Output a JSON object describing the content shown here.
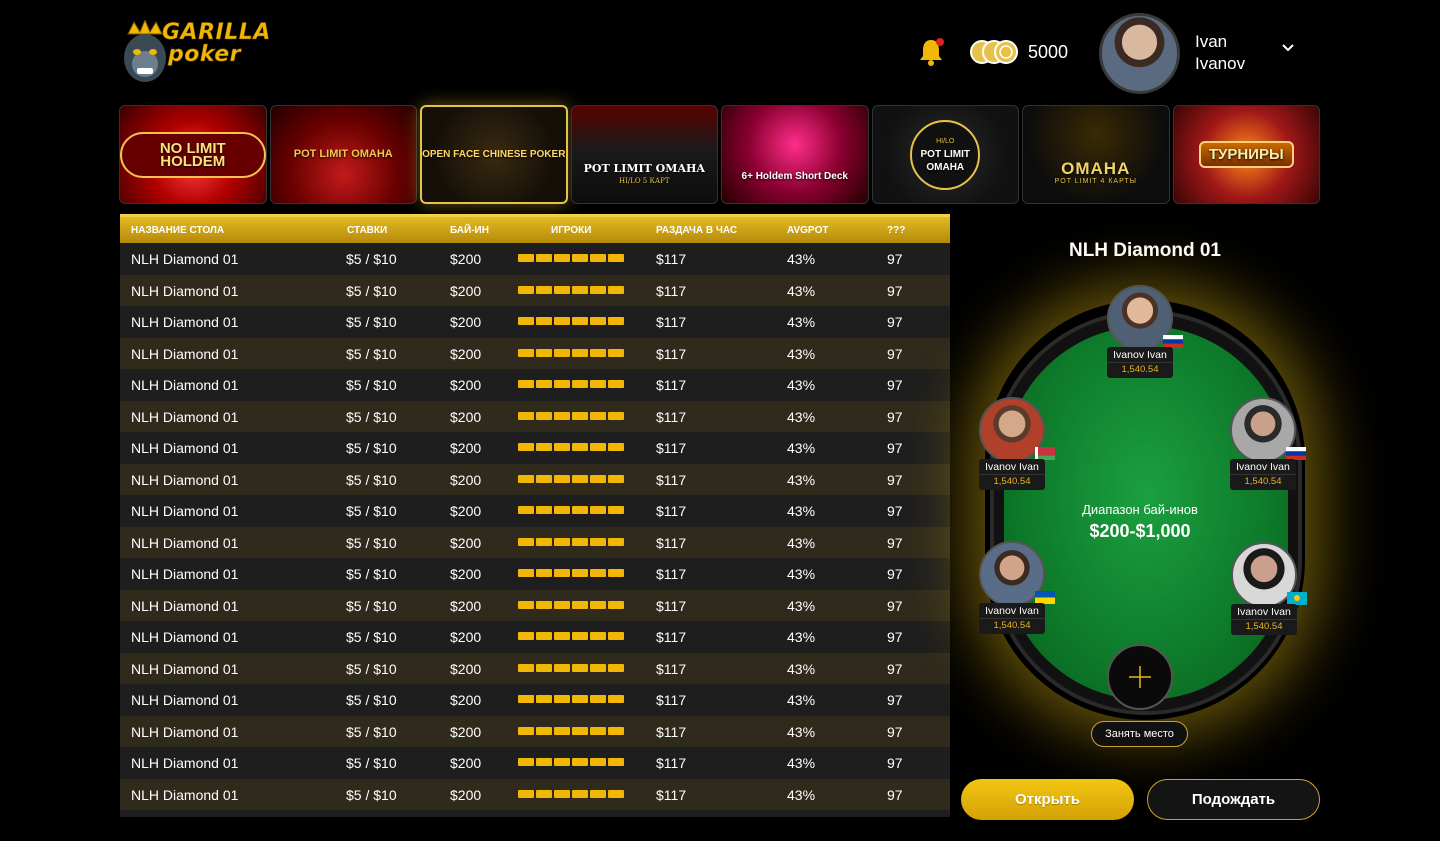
{
  "brand": {
    "line1": "GARILLA",
    "line2": "poker"
  },
  "header": {
    "balance": "5000",
    "user_first": "Ivan",
    "user_last": "Ivanov",
    "notification_icon": "bell-icon",
    "chips_icon": "chips-icon"
  },
  "games": [
    {
      "label": "NO LIMIT HOLDEM",
      "sub": ""
    },
    {
      "label": "POT LIMIT OMAHA",
      "sub": ""
    },
    {
      "label": "OPEN FACE CHINESE POKER",
      "sub": ""
    },
    {
      "label": "POT LIMIT OMAHA",
      "sub": "HI/LO 5 КАРТ"
    },
    {
      "label": "6+ Holdem Short Deck",
      "sub": ""
    },
    {
      "label": "POT LIMIT OMAHA",
      "sub": "HI/LO"
    },
    {
      "label": "OMAHA",
      "sub": "POT LIMIT 4 КАРТЫ"
    },
    {
      "label": "ТУРНИРЫ",
      "sub": ""
    }
  ],
  "table": {
    "headers": [
      "НАЗВАНИЕ СТОЛА",
      "СТАВКИ",
      "БАЙ-ИН",
      "ИГРОКИ",
      "РАЗДАЧА В ЧАС",
      "AVGPOT",
      "???"
    ],
    "players_filled": 6,
    "rows": [
      [
        "NLH Diamond 01",
        "$5 / $10",
        "$200",
        "$117",
        "43%",
        "97"
      ],
      [
        "NLH Diamond 01",
        "$5 / $10",
        "$200",
        "$117",
        "43%",
        "97"
      ],
      [
        "NLH Diamond 01",
        "$5 / $10",
        "$200",
        "$117",
        "43%",
        "97"
      ],
      [
        "NLH Diamond 01",
        "$5 / $10",
        "$200",
        "$117",
        "43%",
        "97"
      ],
      [
        "NLH Diamond 01",
        "$5 / $10",
        "$200",
        "$117",
        "43%",
        "97"
      ],
      [
        "NLH Diamond 01",
        "$5 / $10",
        "$200",
        "$117",
        "43%",
        "97"
      ],
      [
        "NLH Diamond 01",
        "$5 / $10",
        "$200",
        "$117",
        "43%",
        "97"
      ],
      [
        "NLH Diamond 01",
        "$5 / $10",
        "$200",
        "$117",
        "43%",
        "97"
      ],
      [
        "NLH Diamond 01",
        "$5 / $10",
        "$200",
        "$117",
        "43%",
        "97"
      ],
      [
        "NLH Diamond 01",
        "$5 / $10",
        "$200",
        "$117",
        "43%",
        "97"
      ],
      [
        "NLH Diamond 01",
        "$5 / $10",
        "$200",
        "$117",
        "43%",
        "97"
      ],
      [
        "NLH Diamond 01",
        "$5 / $10",
        "$200",
        "$117",
        "43%",
        "97"
      ],
      [
        "NLH Diamond 01",
        "$5 / $10",
        "$200",
        "$117",
        "43%",
        "97"
      ],
      [
        "NLH Diamond 01",
        "$5 / $10",
        "$200",
        "$117",
        "43%",
        "97"
      ],
      [
        "NLH Diamond 01",
        "$5 / $10",
        "$200",
        "$117",
        "43%",
        "97"
      ],
      [
        "NLH Diamond 01",
        "$5 / $10",
        "$200",
        "$117",
        "43%",
        "97"
      ],
      [
        "NLH Diamond 01",
        "$5 / $10",
        "$200",
        "$117",
        "43%",
        "97"
      ],
      [
        "NLH Diamond 01",
        "$5 / $10",
        "$200",
        "$117",
        "43%",
        "97"
      ]
    ]
  },
  "detail": {
    "title": "NLH Diamond 01",
    "buyin_label": "Диапазон бай-инов",
    "buyin_value": "$200-$1,000",
    "seats": [
      {
        "name": "Ivanov Ivan",
        "chips": "1,540.54",
        "flag": "russia"
      },
      {
        "name": "Ivanov Ivan",
        "chips": "1,540.54",
        "flag": "belarus"
      },
      {
        "name": "Ivanov Ivan",
        "chips": "1,540.54",
        "flag": "russia"
      },
      {
        "name": "Ivanov Ivan",
        "chips": "1,540.54",
        "flag": "ukraine"
      },
      {
        "name": "Ivanov Ivan",
        "chips": "1,540.54",
        "flag": "kazakhstan"
      }
    ],
    "take_seat": "Занять место",
    "open": "Открыть",
    "wait": "Подождать"
  },
  "colors": {
    "accent": "#f2b705",
    "felt": "#0e7a2a",
    "row_alt": "#2f2a1c",
    "row": "#1e1e1e"
  }
}
